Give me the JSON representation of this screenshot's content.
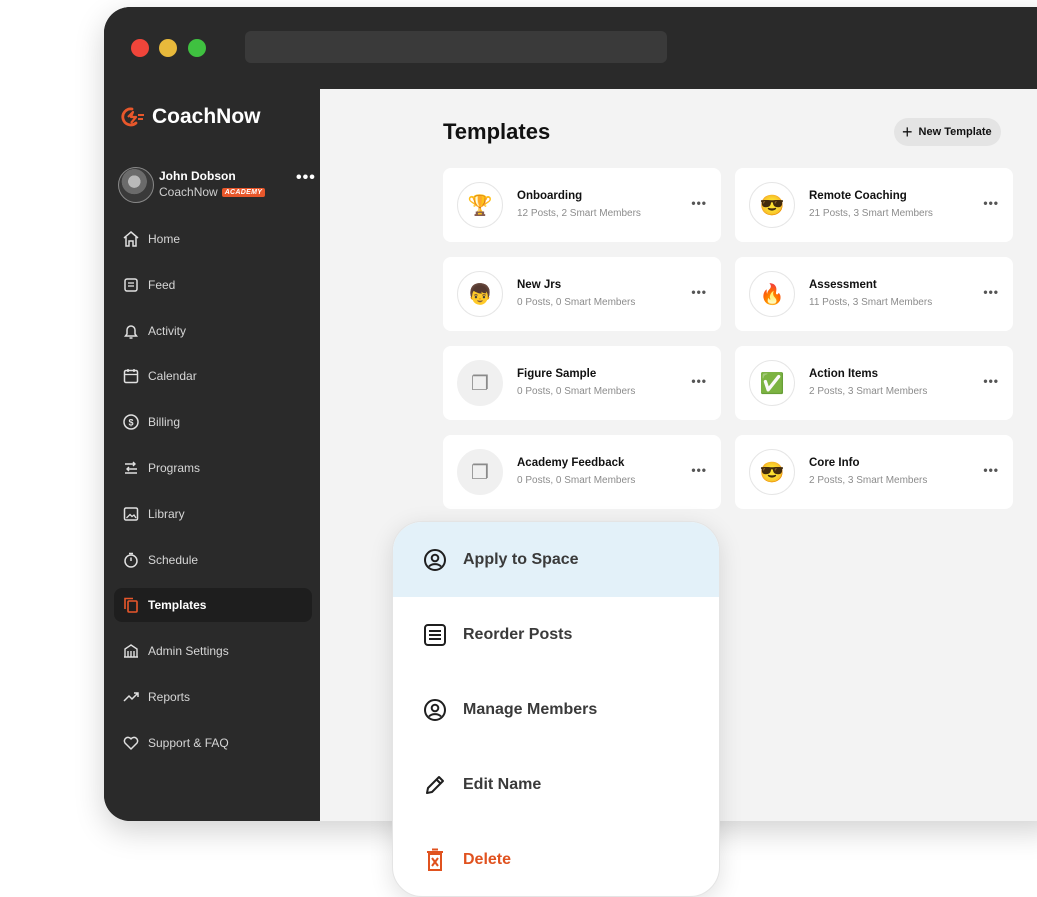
{
  "brand": {
    "name": "CoachNow",
    "accent": "#E8572B"
  },
  "user": {
    "name": "John Dobson",
    "org": "CoachNow",
    "badge": "ACADEMY",
    "more": "•••"
  },
  "nav": [
    {
      "label": "Home",
      "icon": "home-icon"
    },
    {
      "label": "Feed",
      "icon": "feed-icon"
    },
    {
      "label": "Activity",
      "icon": "bell-icon"
    },
    {
      "label": "Calendar",
      "icon": "calendar-icon"
    },
    {
      "label": "Billing",
      "icon": "dollar-icon"
    },
    {
      "label": "Programs",
      "icon": "programs-icon"
    },
    {
      "label": "Library",
      "icon": "image-icon"
    },
    {
      "label": "Schedule",
      "icon": "stopwatch-icon"
    },
    {
      "label": "Templates",
      "icon": "templates-icon",
      "active": true
    },
    {
      "label": "Admin Settings",
      "icon": "admin-building-icon"
    },
    {
      "label": "Reports",
      "icon": "trend-icon"
    },
    {
      "label": "Support & FAQ",
      "icon": "heart-icon"
    }
  ],
  "page": {
    "title": "Templates",
    "new_button": "New Template",
    "new_plus": "+"
  },
  "templates": [
    {
      "name": "Onboarding",
      "meta": "12 Posts, 2 Smart Members",
      "emoji": "🏆",
      "more": "•••"
    },
    {
      "name": "Remote Coaching",
      "meta": "21 Posts, 3 Smart Members",
      "emoji": "😎",
      "more": "•••"
    },
    {
      "name": "New Jrs",
      "meta": "0 Posts, 0 Smart Members",
      "emoji": "👦",
      "more": "•••"
    },
    {
      "name": "Assessment",
      "meta": "11 Posts, 3 Smart Members",
      "emoji": "🔥",
      "more": "•••"
    },
    {
      "name": "Figure Sample",
      "meta": "0 Posts, 0 Smart Members",
      "emoji": "❐",
      "more": "•••"
    },
    {
      "name": "Action Items",
      "meta": "2 Posts, 3 Smart Members",
      "emoji": "✅",
      "more": "•••"
    },
    {
      "name": "Academy Feedback",
      "meta": "0 Posts, 0 Smart Members",
      "emoji": "❐",
      "more": "•••"
    },
    {
      "name": "Core Info",
      "meta": "2 Posts, 3 Smart Members",
      "emoji": "😎",
      "more": "•••"
    }
  ],
  "menu": [
    {
      "label": "Apply to Space",
      "icon": "user-circle-icon"
    },
    {
      "label": "Reorder Posts",
      "icon": "list-icon"
    },
    {
      "label": "Manage Members",
      "icon": "user-circle-icon"
    },
    {
      "label": "Edit Name",
      "icon": "pencil-icon"
    },
    {
      "label": "Delete",
      "icon": "trash-icon"
    }
  ]
}
